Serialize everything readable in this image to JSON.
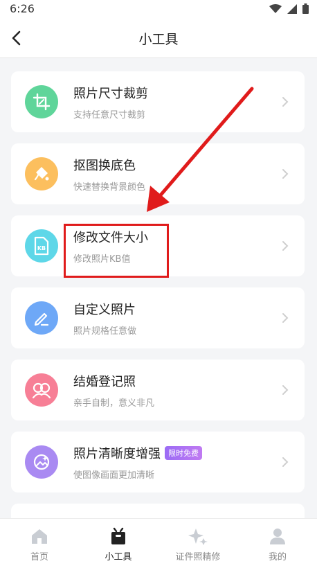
{
  "status": {
    "time": "6:26"
  },
  "nav": {
    "title": "小工具"
  },
  "tools": [
    {
      "title": "照片尺寸裁剪",
      "subtitle": "支持任意尺寸裁剪",
      "icon": "crop-icon",
      "color": "#5fd59a"
    },
    {
      "title": "抠图换底色",
      "subtitle": "快速替换背景颜色",
      "icon": "paint-bucket-icon",
      "color": "#fcbf5e"
    },
    {
      "title": "修改文件大小",
      "subtitle": "修改照片KB值",
      "icon": "kb-file-icon",
      "color": "#5ed7e8"
    },
    {
      "title": "自定义照片",
      "subtitle": "照片规格任意做",
      "icon": "pencil-icon",
      "color": "#6ea8f7"
    },
    {
      "title": "结婚登记照",
      "subtitle": "亲手自制，意义非凡",
      "icon": "couple-icon",
      "color": "#f77f96"
    },
    {
      "title": "照片清晰度增强",
      "subtitle": "使图像画面更加清晰",
      "icon": "enhance-icon",
      "color": "#a98af2",
      "badge": "限时免费"
    }
  ],
  "tabs": [
    {
      "label": "首页",
      "icon": "home-icon",
      "active": false
    },
    {
      "label": "小工具",
      "icon": "toolbox-icon",
      "active": true
    },
    {
      "label": "证件照精修",
      "icon": "sparkle-icon",
      "active": false
    },
    {
      "label": "我的",
      "icon": "profile-icon",
      "active": false
    }
  ],
  "colors": {
    "highlight": "#e01b1b",
    "background": "#f4f5f7"
  }
}
